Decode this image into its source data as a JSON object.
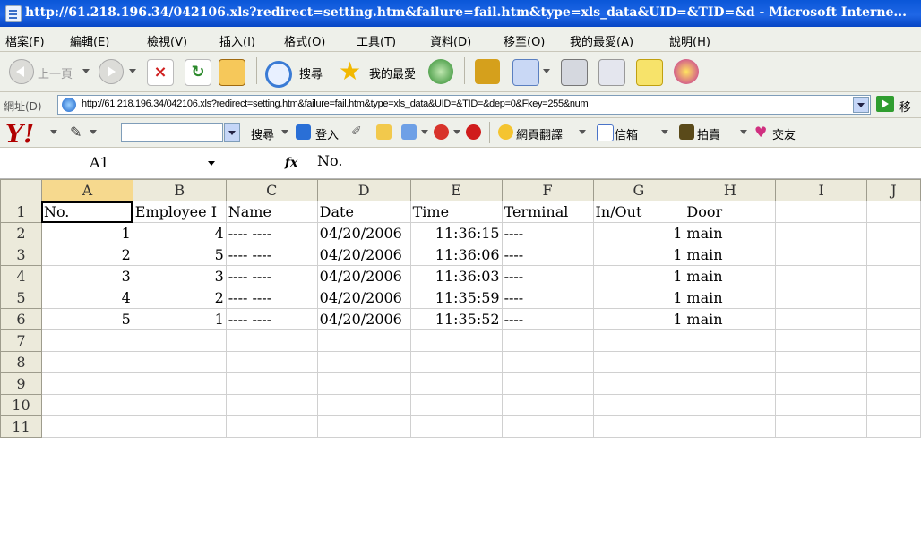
{
  "window": {
    "title": "http://61.218.196.34/042106.xls?redirect=setting.htm&failure=fail.htm&type=xls_data&UID=&TID=&d - Microsoft Interne..."
  },
  "menu": [
    "檔案(F)",
    "編輯(E)",
    "檢視(V)",
    "插入(I)",
    "格式(O)",
    "工具(T)",
    "資料(D)",
    "移至(O)",
    "我的最愛(A)",
    "說明(H)"
  ],
  "toolbar": {
    "back_label": "上一頁",
    "search_label": "搜尋",
    "favorites_label": "我的最愛"
  },
  "address": {
    "label": "網址(D)",
    "url": "http://61.218.196.34/042106.xls?redirect=setting.htm&failure=fail.htm&type=xls_data&UID=&TID=&dep=0&Fkey=255&num",
    "go_label": "移"
  },
  "yahoo_toolbar": {
    "search_label": "搜尋",
    "login_label": "登入",
    "translate_label": "網頁翻譯",
    "mail_label": "信箱",
    "auction_label": "拍賣",
    "dating_label": "交友"
  },
  "formula": {
    "name_box": "A1",
    "fx": "fx",
    "content": "No."
  },
  "sheet": {
    "columns": [
      "A",
      "B",
      "C",
      "D",
      "E",
      "F",
      "G",
      "H",
      "I",
      "J"
    ],
    "row_numbers": [
      "1",
      "2",
      "3",
      "4",
      "5",
      "6",
      "7",
      "8",
      "9",
      "10",
      "11"
    ],
    "header": [
      "No.",
      "Employee I",
      "Name",
      "Date",
      "Time",
      "Terminal",
      "In/Out",
      "Door",
      "",
      ""
    ],
    "rows": [
      [
        "1",
        "4",
        "---- ----",
        "04/20/2006",
        "11:36:15",
        "----",
        "1",
        "main",
        "",
        ""
      ],
      [
        "2",
        "5",
        "---- ----",
        "04/20/2006",
        "11:36:06",
        "----",
        "1",
        "main",
        "",
        ""
      ],
      [
        "3",
        "3",
        "---- ----",
        "04/20/2006",
        "11:36:03",
        "----",
        "1",
        "main",
        "",
        ""
      ],
      [
        "4",
        "2",
        "---- ----",
        "04/20/2006",
        "11:35:59",
        "----",
        "1",
        "main",
        "",
        ""
      ],
      [
        "5",
        "1",
        "---- ----",
        "04/20/2006",
        "11:35:52",
        "----",
        "1",
        "main",
        "",
        ""
      ],
      [
        "",
        "",
        "",
        "",
        "",
        "",
        "",
        "",
        "",
        ""
      ],
      [
        "",
        "",
        "",
        "",
        "",
        "",
        "",
        "",
        "",
        ""
      ],
      [
        "",
        "",
        "",
        "",
        "",
        "",
        "",
        "",
        "",
        ""
      ],
      [
        "",
        "",
        "",
        "",
        "",
        "",
        "",
        "",
        "",
        ""
      ],
      [
        "",
        "",
        "",
        "",
        "",
        "",
        "",
        "",
        "",
        ""
      ]
    ]
  }
}
